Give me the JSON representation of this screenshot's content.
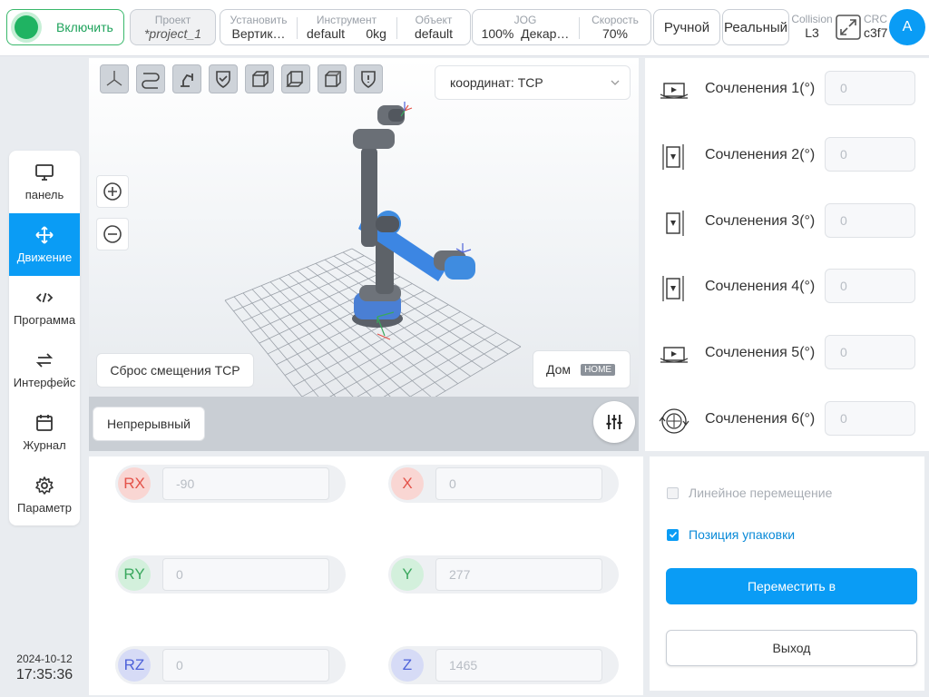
{
  "topbar": {
    "power_label": "Включить",
    "project_key": "Проект",
    "project_value": "*project_1",
    "setup": [
      {
        "key": "Установить",
        "value": "Вертик…"
      },
      {
        "key": "Инструмент",
        "value": "default      0kg"
      },
      {
        "key": "Объект",
        "value": "default"
      }
    ],
    "jog_key": "JOG",
    "jog_value": "100%  Декар…",
    "speed_key": "Скорость",
    "speed_value": "70%",
    "manual_label": "Ручной",
    "real_label": "Реальный",
    "collision_key": "Collision",
    "collision_value": "L3",
    "crc_key": "CRC",
    "crc_value": "c3f7",
    "avatar_letter": "A"
  },
  "nav": {
    "items": [
      {
        "label": "панель",
        "icon": "monitor-icon"
      },
      {
        "label": "Движение",
        "icon": "move-arrows-icon"
      },
      {
        "label": "Программа",
        "icon": "code-icon"
      },
      {
        "label": "Интерфейс",
        "icon": "swap-arrows-icon"
      },
      {
        "label": "Журнал",
        "icon": "calendar-icon"
      },
      {
        "label": "Параметр",
        "icon": "gear-icon"
      }
    ],
    "active_index": 1
  },
  "clock": {
    "date": "2024-10-12",
    "time": "17:35:36"
  },
  "viewport": {
    "coord_label": "координат: TCP",
    "reset_tcp_label": "Сброс смещения TCP",
    "home_label": "Дом",
    "home_badge": "HOME",
    "continuous_label": "Непрерывный"
  },
  "joints": [
    {
      "label": "Сочленения 1(°)",
      "value": "0"
    },
    {
      "label": "Сочленения 2(°)",
      "value": "0"
    },
    {
      "label": "Сочленения 3(°)",
      "value": "0"
    },
    {
      "label": "Сочленения 4(°)",
      "value": "0"
    },
    {
      "label": "Сочленения 5(°)",
      "value": "0"
    },
    {
      "label": "Сочленения 6(°)",
      "value": "0"
    }
  ],
  "cartesian": {
    "rx": {
      "label": "RX",
      "value": "-90"
    },
    "ry": {
      "label": "RY",
      "value": "0"
    },
    "rz": {
      "label": "RZ",
      "value": "0"
    },
    "x": {
      "label": "X",
      "value": "0"
    },
    "y": {
      "label": "Y",
      "value": "277"
    },
    "z": {
      "label": "Z",
      "value": "1465"
    }
  },
  "actions": {
    "linear_label": "Линейное перемещение",
    "linear_checked": false,
    "pack_label": "Позиция упаковки",
    "pack_checked": true,
    "move_label": "Переместить в",
    "exit_label": "Выход"
  },
  "colors": {
    "accent": "#0a9cf5",
    "power_green": "#1fb362",
    "axis_red": "#e4534a",
    "axis_green": "#3aa85e",
    "axis_blue": "#4e62d9"
  }
}
